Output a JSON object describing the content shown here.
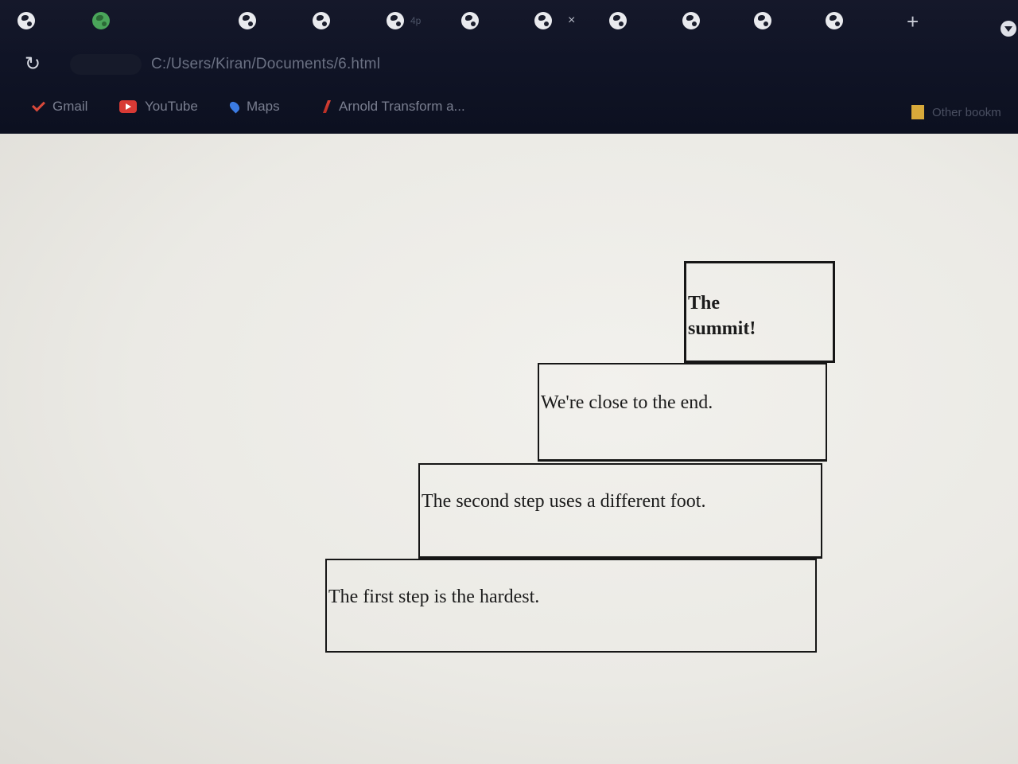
{
  "browser": {
    "tabs": [
      {
        "label": "",
        "icon": "globe-icon"
      },
      {
        "label": "",
        "icon": "whatsapp-icon"
      },
      {
        "label": "",
        "icon": "globe-icon"
      },
      {
        "label": "",
        "icon": "globe-icon"
      },
      {
        "label": "4p",
        "icon": "globe-icon"
      },
      {
        "label": "",
        "icon": "globe-icon"
      },
      {
        "label": "",
        "icon": "globe-icon",
        "active": true
      },
      {
        "label": "",
        "icon": "globe-icon"
      },
      {
        "label": "",
        "icon": "globe-icon"
      },
      {
        "label": "",
        "icon": "globe-icon"
      },
      {
        "label": "",
        "icon": "globe-icon"
      }
    ],
    "active_tab_close": "×",
    "new_tab": "+",
    "address": "C:/Users/Kiran/Documents/6.html",
    "bookmarks": [
      {
        "label": "Gmail",
        "icon": "gmail-icon"
      },
      {
        "label": "YouTube",
        "icon": "youtube-icon"
      },
      {
        "label": "Maps",
        "icon": "maps-icon"
      },
      {
        "label": "Arnold Transform a...",
        "icon": "acrobat-icon"
      }
    ],
    "other_bookmarks": "Other bookm"
  },
  "page": {
    "steps": [
      {
        "text": "The first step is the hardest."
      },
      {
        "text": "The second step uses a different foot."
      },
      {
        "text": "We're close to the end."
      },
      {
        "text": "The summit!"
      }
    ]
  }
}
